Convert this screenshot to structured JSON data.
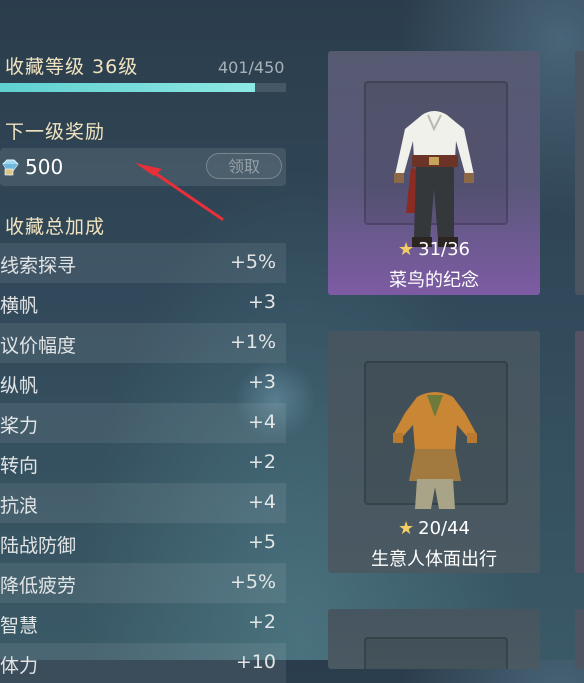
{
  "collection": {
    "level_title": "收藏等级 36级",
    "progress_text": "401/450",
    "progress_current": 401,
    "progress_max": 450
  },
  "next_reward": {
    "title": "下一级奖励",
    "amount": "500",
    "claim_label": "领取",
    "icon": "gem-icon"
  },
  "bonus": {
    "title": "收藏总加成",
    "stats": [
      {
        "name": "线索探寻",
        "value": "+5%"
      },
      {
        "name": "横帆",
        "value": "+3"
      },
      {
        "name": "议价幅度",
        "value": "+1%"
      },
      {
        "name": "纵帆",
        "value": "+3"
      },
      {
        "name": "桨力",
        "value": "+4"
      },
      {
        "name": "转向",
        "value": "+2"
      },
      {
        "name": "抗浪",
        "value": "+4"
      },
      {
        "name": "陆战防御",
        "value": "+5"
      },
      {
        "name": "降低疲劳",
        "value": "+5%"
      },
      {
        "name": "智慧",
        "value": "+2"
      },
      {
        "name": "体力",
        "value": "+10"
      }
    ]
  },
  "cards": [
    {
      "count": "31/36",
      "name": "菜鸟的纪念",
      "icon": "white-shirt-outfit-icon"
    },
    {
      "count": "20/44",
      "name": "生意人体面出行",
      "icon": "leather-outfit-icon"
    }
  ],
  "colors": {
    "accent": "#6fdcd6",
    "gold_text": "#f0e3bf",
    "star": "#f3cd63",
    "arrow": "#e8303a"
  }
}
